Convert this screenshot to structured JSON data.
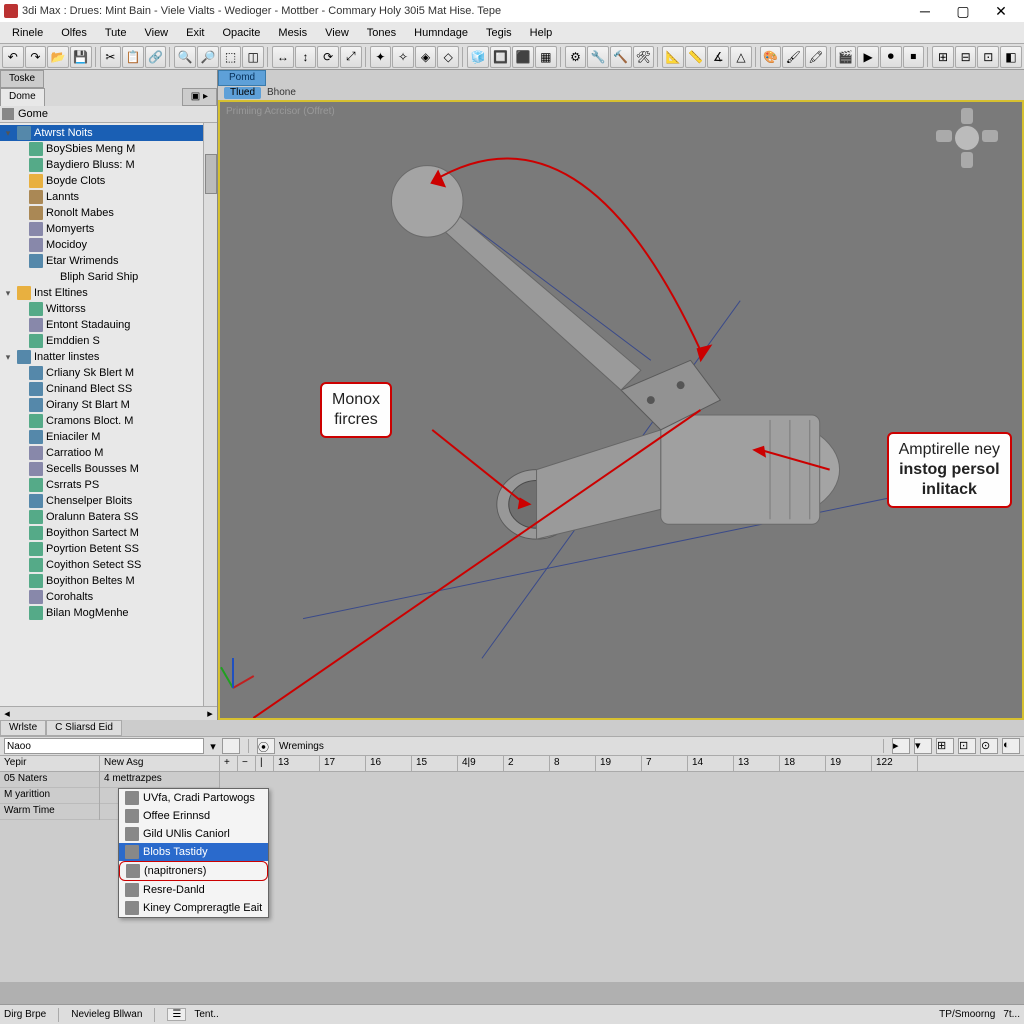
{
  "window": {
    "title": "3di Max : Drues: Mint Bain - Viele Vialts - Wedioger - Mottber - Commary Holy 30i5 Mat Hise. Tepe"
  },
  "menubar": [
    "Rinele",
    "Olfes",
    "Tute",
    "View",
    "Exit",
    "Opacite",
    "Mesis",
    "View",
    "Tones",
    "Humndage",
    "Tegis",
    "Help"
  ],
  "left": {
    "tab1": "Toske",
    "tab2": "Dome",
    "header": "Gome",
    "groups": [
      {
        "label": "Atwrst Noits",
        "depth": 0,
        "selected": true,
        "icon": "obj2"
      },
      {
        "label": "BoySbies Meng M",
        "depth": 1,
        "icon": "obj"
      },
      {
        "label": "Baydiero Bluss: M",
        "depth": 1,
        "icon": "obj"
      },
      {
        "label": "Boyde Clots",
        "depth": 1,
        "icon": "folder"
      },
      {
        "label": "Lannts",
        "depth": 1,
        "icon": "obj3"
      },
      {
        "label": "Ronolt Mabes",
        "depth": 1,
        "icon": "obj3"
      },
      {
        "label": "Momyerts",
        "depth": 1,
        "icon": "obj4"
      },
      {
        "label": "Mocidoy",
        "depth": 1,
        "icon": "obj4"
      },
      {
        "label": "Etar Wrimends",
        "depth": 1,
        "icon": "obj2"
      },
      {
        "label": "Bliph Sarid Ship",
        "depth": 2,
        "icon": ""
      },
      {
        "label": "Inst Eltines",
        "depth": 0,
        "icon": "folder"
      },
      {
        "label": "Wittorss",
        "depth": 1,
        "icon": "obj"
      },
      {
        "label": "Entont Stadauing",
        "depth": 1,
        "icon": "obj4"
      },
      {
        "label": "Emddien S",
        "depth": 1,
        "icon": "obj"
      },
      {
        "label": "Inatter linstes",
        "depth": 0,
        "icon": "obj2"
      },
      {
        "label": "Crliany Sk Blert M",
        "depth": 1,
        "icon": "obj2"
      },
      {
        "label": "Cninand Blect SS",
        "depth": 1,
        "icon": "obj2"
      },
      {
        "label": "Oirany St Blart M",
        "depth": 1,
        "icon": "obj2"
      },
      {
        "label": "Cramons Bloct. M",
        "depth": 1,
        "icon": "obj"
      },
      {
        "label": "Eniaciler M",
        "depth": 1,
        "icon": "obj2"
      },
      {
        "label": "Carratioo M",
        "depth": 1,
        "icon": "obj4"
      },
      {
        "label": "Secells Bousses M",
        "depth": 1,
        "icon": "obj4"
      },
      {
        "label": "Csrrats PS",
        "depth": 1,
        "icon": "obj"
      },
      {
        "label": "Chenselper Bloits",
        "depth": 1,
        "icon": "obj2"
      },
      {
        "label": "Oralunn Batera SS",
        "depth": 1,
        "icon": "obj"
      },
      {
        "label": "Boyithon Sartect M",
        "depth": 1,
        "icon": "obj"
      },
      {
        "label": "Poyrtion Betent SS",
        "depth": 1,
        "icon": "obj"
      },
      {
        "label": "Coyithon Setect SS",
        "depth": 1,
        "icon": "obj"
      },
      {
        "label": "Boyithon Beltes M",
        "depth": 1,
        "icon": "obj"
      },
      {
        "label": "Corohalts",
        "depth": 1,
        "icon": "obj4"
      },
      {
        "label": "Bilan MogMenhe",
        "depth": 1,
        "icon": "obj"
      }
    ]
  },
  "viewport": {
    "tab_active": "Pomd",
    "tab_sub1": "Tlued",
    "tab_sub2": "Bhone",
    "label": "Primiing Acrcisor (Offret)",
    "callout1_line1": "Monox",
    "callout1_line2": "fircres",
    "callout2_line1": "Amptirelle ney",
    "callout2_line2": "instog persol",
    "callout2_line3": "inlitack"
  },
  "tabbar2": [
    "Wrlste",
    "C Sliarsd Eid"
  ],
  "transform": {
    "name_value": "Naoo",
    "warnings": "Wremings"
  },
  "dopesheet": {
    "col1": "Yepir",
    "col2": "New Asg",
    "ticks": [
      "13",
      "17",
      "16",
      "15",
      "4|9",
      "2",
      "8",
      "19",
      "7",
      "14",
      "13",
      "18",
      "19",
      "122"
    ],
    "rows_left": [
      "05 Naters",
      "M yarittion",
      "Warm Time"
    ],
    "rows_mid": [
      "4 mettrazpes",
      "",
      ""
    ]
  },
  "context_menu": [
    {
      "label": "UVfa, Cradi Partowogs"
    },
    {
      "label": "Offee Erinnsd"
    },
    {
      "label": "Gild UNlis Caniorl"
    },
    {
      "label": "Blobs Tastidy",
      "selected": true
    },
    {
      "label": "(napitroners)",
      "highlighted": true
    },
    {
      "label": "Resre-Danld"
    },
    {
      "label": "Kiney Compreragtle Eait"
    }
  ],
  "statusbar": {
    "left1": "Dirg Brpe",
    "left2": "Nevieleg Bllwan",
    "left3": "Tent..",
    "right1": "TP/Smoorng",
    "right2": "7t..."
  }
}
